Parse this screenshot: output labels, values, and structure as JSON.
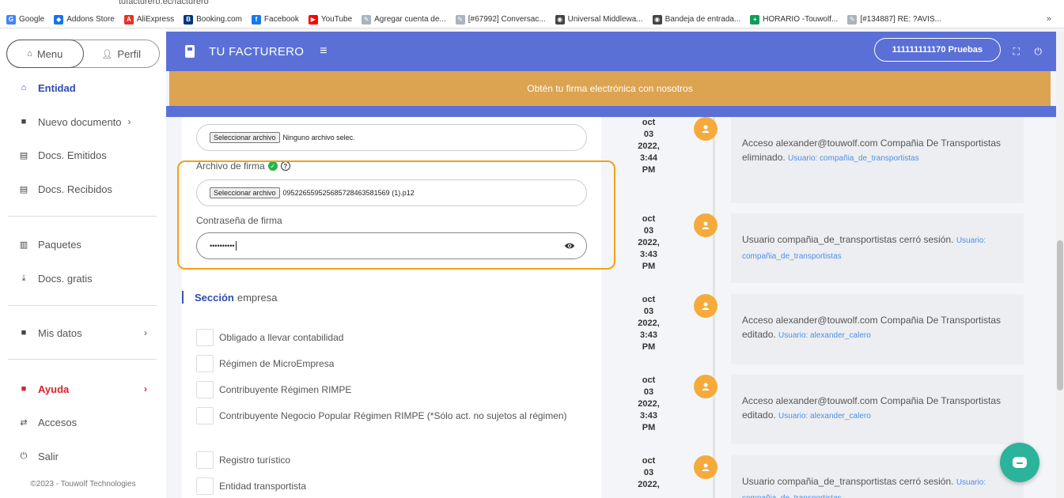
{
  "browser": {
    "url": "tufacturero.ec/facturero",
    "bookmarks": [
      {
        "label": "Google",
        "color": "#4285f4",
        "glyph": "G"
      },
      {
        "label": "Addons Store",
        "color": "#1a73e8",
        "glyph": "◆"
      },
      {
        "label": "AliExpress",
        "color": "#e43225",
        "glyph": "A"
      },
      {
        "label": "Booking.com",
        "color": "#003580",
        "glyph": "B"
      },
      {
        "label": "Facebook",
        "color": "#1877f2",
        "glyph": "f"
      },
      {
        "label": "YouTube",
        "color": "#ff0000",
        "glyph": "▶"
      },
      {
        "label": "Agregar cuenta de...",
        "color": "#aab4be",
        "glyph": "✎"
      },
      {
        "label": "[#67992] Conversac...",
        "color": "#aab4be",
        "glyph": "✎"
      },
      {
        "label": "Universal Middlewa...",
        "color": "#444444",
        "glyph": "◉"
      },
      {
        "label": "Bandeja de entrada...",
        "color": "#444444",
        "glyph": "◉"
      },
      {
        "label": "HORARIO -Touwolf...",
        "color": "#0f9d58",
        "glyph": "+"
      },
      {
        "label": "[#134887] RE: ?AVIS...",
        "color": "#aab4be",
        "glyph": "✎"
      }
    ],
    "more": "»"
  },
  "sidebar": {
    "menu_label": "Menu",
    "profile_label": "Perfil",
    "items": [
      {
        "label": "Entidad",
        "icon": "home-icon"
      },
      {
        "label": "Nuevo documento",
        "icon": "plus-square-icon"
      },
      {
        "label": "Docs. Emitidos",
        "icon": "clipboard-icon"
      },
      {
        "label": "Docs. Recibidos",
        "icon": "clipboard-icon"
      },
      {
        "label": "Paquetes",
        "icon": "bars-icon"
      },
      {
        "label": "Docs. gratis",
        "icon": "download-icon"
      },
      {
        "label": "Mis datos",
        "icon": "plus-square-icon"
      },
      {
        "label": "Ayuda",
        "icon": "plus-square-icon"
      },
      {
        "label": "Accesos",
        "icon": "swap-icon"
      },
      {
        "label": "Salir",
        "icon": "power-icon"
      }
    ],
    "copyright": "©2023 - Touwolf Technologies"
  },
  "header": {
    "brand": "TU FACTURERO",
    "account": "111111111170 Pruebas",
    "banner": "Obtén tu firma electrónica con nosotros"
  },
  "form": {
    "file_button": "Seleccionar archivo",
    "file1_value": "Ninguno archivo selec.",
    "firma_label": "Archivo de firma",
    "file2_value": "0952265595256857284635815​69 (1).p12",
    "password_label": "Contraseña de firma",
    "password_value": "••••••••••",
    "section_bold": "Sección",
    "section_rest": "empresa",
    "checkboxes": [
      "Obligado a llevar contabilidad",
      "Régimen de MicroEmpresa",
      "Contribuyente Régimen RIMPE",
      "Contribuyente Negocio Popular Régimen RIMPE (*Sólo act. no sujetos al régimen)",
      "Registro turístico",
      "Entidad transportista"
    ]
  },
  "timeline": [
    {
      "d1": "oct",
      "d2": "03",
      "d3": "2022,",
      "d4": "3:44",
      "d5": "PM",
      "text": "Acceso alexander@touwolf.com Compañia De Transportistas eliminado.",
      "link": "Usuario: compañia_de_transportistas"
    },
    {
      "d1": "oct",
      "d2": "03",
      "d3": "2022,",
      "d4": "3:43",
      "d5": "PM",
      "text": "Usuario compañia_de_transportistas cerró sesión.",
      "link": "Usuario: compañia_de_transportistas"
    },
    {
      "d1": "oct",
      "d2": "03",
      "d3": "2022,",
      "d4": "3:43",
      "d5": "PM",
      "text": "Acceso alexander@touwolf.com Compañia De Transportistas editado.",
      "link": "Usuario: alexander_calero"
    },
    {
      "d1": "oct",
      "d2": "03",
      "d3": "2022,",
      "d4": "3:43",
      "d5": "PM",
      "text": "Acceso alexander@touwolf.com Compañia De Transportistas editado.",
      "link": "Usuario: alexander_calero"
    },
    {
      "d1": "oct",
      "d2": "03",
      "d3": "2022,",
      "d4": "",
      "d5": "",
      "text": "Usuario compañia_de_transportistas cerró sesión.",
      "link": "Usuario: compañia_de_transportistas"
    }
  ]
}
